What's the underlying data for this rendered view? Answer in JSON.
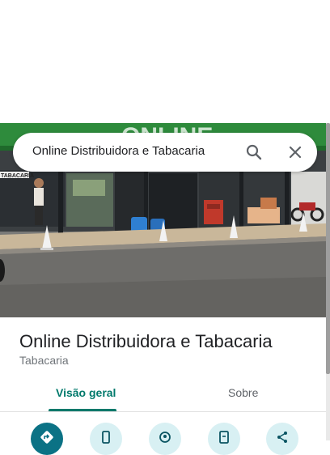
{
  "search": {
    "query": "Online Distribuidora e Tabacaria",
    "search_icon": "search-icon",
    "close_icon": "close-icon"
  },
  "photo": {
    "storefront_sign_text": "ONLINE",
    "side_sign_text": "TABACARIA"
  },
  "place": {
    "name": "Online Distribuidora e Tabacaria",
    "category": "Tabacaria"
  },
  "tabs": [
    {
      "label": "Visão geral",
      "active": true
    },
    {
      "label": "Sobre",
      "active": false
    }
  ],
  "actions": [
    {
      "icon": "directions-icon"
    },
    {
      "icon": "phone-icon"
    },
    {
      "icon": "save-icon"
    },
    {
      "icon": "send-to-phone-icon"
    },
    {
      "icon": "share-icon"
    }
  ],
  "colors": {
    "accent": "#00796b",
    "primary_action": "#0b7285",
    "action_bg": "#d8f0f3"
  }
}
